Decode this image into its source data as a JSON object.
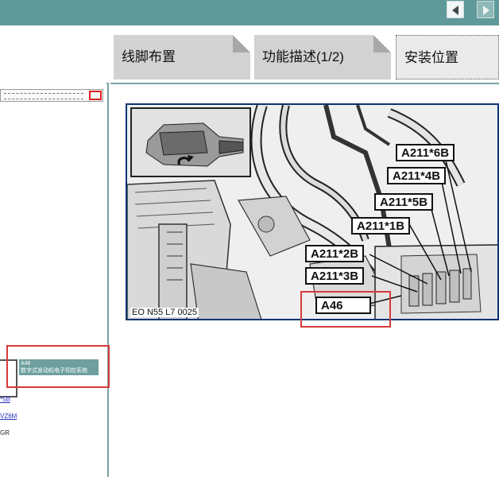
{
  "nav": {
    "prev_icon": "triangle-left-icon",
    "next_icon": "triangle-right-icon"
  },
  "tabs": [
    {
      "label": "线脚布置",
      "active": false
    },
    {
      "label": "功能描述(1/2)",
      "active": false
    },
    {
      "label": "安装位置",
      "active": true
    }
  ],
  "left_panel": {
    "component_code": "A46",
    "component_name": "数字式发动机电子伺控系统",
    "links": [
      "*5B",
      "VZ6M"
    ],
    "plain_text": "GR"
  },
  "figure": {
    "caption": "EO N55 L7 0025",
    "callouts": [
      "A211*6B",
      "A211*4B",
      "A211*5B",
      "A211*1B",
      "A211*2B",
      "A211*3B",
      "A46"
    ]
  },
  "colors": {
    "header": "#5f9999",
    "highlight": "#d63a3a",
    "figure_border": "#0a3570"
  }
}
